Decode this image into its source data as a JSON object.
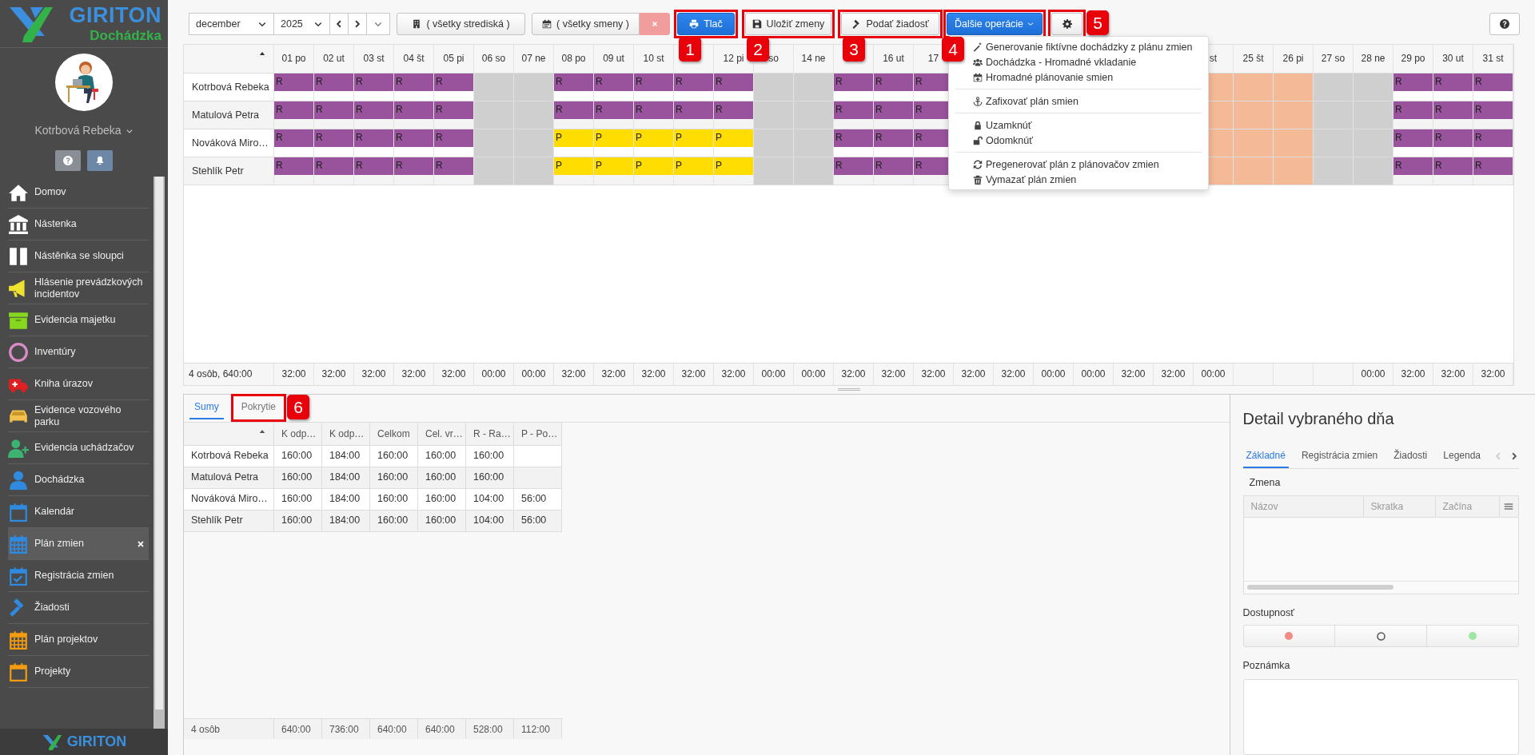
{
  "sidebar": {
    "brand": {
      "name": "GIRITON",
      "product": "Dochádzka"
    },
    "user": {
      "name": "Kotrbová Rebeka"
    },
    "items": [
      {
        "label": "Domov",
        "selected": false
      },
      {
        "label": "Nástenka",
        "selected": false
      },
      {
        "label": "Nástěnka se sloupci",
        "selected": false
      },
      {
        "label": "Hlásenie prevádzkových incidentov",
        "selected": false
      },
      {
        "label": "Evidencia majetku",
        "selected": false
      },
      {
        "label": "Inventúry",
        "selected": false
      },
      {
        "label": "Kniha úrazov",
        "selected": false
      },
      {
        "label": "Evidence vozového parku",
        "selected": false
      },
      {
        "label": "Evidencia uchádzačov",
        "selected": false
      },
      {
        "label": "Dochádzka",
        "selected": false
      },
      {
        "label": "Kalendár",
        "selected": false
      },
      {
        "label": "Plán zmien",
        "selected": true,
        "closable": true
      },
      {
        "label": "Registrácia zmien",
        "selected": false
      },
      {
        "label": "Žiadosti",
        "selected": false
      },
      {
        "label": "Plán projektov",
        "selected": false
      },
      {
        "label": "Projekty",
        "selected": false
      }
    ],
    "footer_brand": "GIRITON"
  },
  "toolbar": {
    "month": "december",
    "year": "2025",
    "period_menu_disabled": true,
    "centers": "( všetky strediská )",
    "shifts": "( všetky smeny )",
    "buttons": [
      {
        "label": "Tlač",
        "kind": "primary",
        "highlighted": true,
        "step": "1"
      },
      {
        "label": "Uložiť zmeny",
        "kind": "default",
        "highlighted": true,
        "step": "2"
      },
      {
        "label": "Podať žiadosť",
        "kind": "default",
        "highlighted": true,
        "step": "3"
      },
      {
        "label": "Ďalšie operácie",
        "kind": "primary-dropdown",
        "highlighted": true,
        "step": "4"
      },
      {
        "kind": "icon",
        "highlighted": true,
        "step": "5"
      }
    ]
  },
  "menu": {
    "open": true,
    "items": [
      {
        "kind": "item",
        "label": "Generovanie fiktívne dochádzky z plánu zmien"
      },
      {
        "kind": "item",
        "label": "Dochádzka - Hromadné vkladanie"
      },
      {
        "kind": "item",
        "label": "Hromadné plánovanie smien"
      },
      {
        "kind": "divider"
      },
      {
        "kind": "item",
        "label": "Zafixovať plán smien"
      },
      {
        "kind": "divider"
      },
      {
        "kind": "item",
        "label": "Uzamknúť"
      },
      {
        "kind": "item",
        "label": "Odomknúť"
      },
      {
        "kind": "divider"
      },
      {
        "kind": "item",
        "label": "Pregenerovať plán z plánovačov zmien"
      },
      {
        "kind": "item",
        "label": "Vymazať plán zmien"
      }
    ]
  },
  "calendar": {
    "days": [
      {
        "header": "01 po",
        "total": "32:00"
      },
      {
        "header": "02 ut",
        "total": "32:00"
      },
      {
        "header": "03 st",
        "total": "32:00"
      },
      {
        "header": "04 št",
        "total": "32:00"
      },
      {
        "header": "05 pi",
        "total": "32:00"
      },
      {
        "header": "06 so",
        "total": "00:00"
      },
      {
        "header": "07 ne",
        "total": "00:00"
      },
      {
        "header": "08 po",
        "total": "32:00"
      },
      {
        "header": "09 ut",
        "total": "32:00"
      },
      {
        "header": "10 st",
        "total": "32:00"
      },
      {
        "total": "32:00"
      },
      {
        "header": "12 pi",
        "total": "32:00"
      },
      {
        "header": "so",
        "total": "00:00"
      },
      {
        "header": "14 ne",
        "total": "00:00"
      },
      {
        "total": "32:00"
      },
      {
        "header": "16 ut",
        "total": "32:00"
      },
      {
        "header": "17",
        "total": "32:00"
      },
      {
        "total": "32:00"
      },
      {
        "total": "32:00"
      },
      {
        "total": "00:00"
      },
      {
        "total": "00:00"
      },
      {
        "total": "32:00"
      },
      {
        "total": "32:00"
      },
      {
        "header": "st",
        "total": "00:00"
      },
      {
        "header": "25 št"
      },
      {
        "header": "26 pi"
      },
      {
        "header": "27 so"
      },
      {
        "header": "28 ne",
        "total": "00:00"
      },
      {
        "header": "29 po",
        "total": "32:00"
      },
      {
        "header": "30 ut",
        "total": "32:00"
      },
      {
        "header": "31 st",
        "total": "32:00"
      }
    ],
    "people": [
      {
        "name": "Kotrbová Rebeka",
        "cells": [
          {
            "kind": "shift",
            "code": "R",
            "color": "#98539c"
          },
          {
            "kind": "shift",
            "code": "R",
            "color": "#98539c"
          },
          {
            "kind": "shift",
            "code": "R",
            "color": "#98539c"
          },
          {
            "kind": "shift",
            "code": "R",
            "color": "#98539c"
          },
          {
            "kind": "shift",
            "code": "R",
            "color": "#98539c"
          },
          {
            "kind": "weekend"
          },
          {
            "kind": "weekend"
          },
          {
            "kind": "shift",
            "code": "R",
            "color": "#98539c"
          },
          {
            "kind": "shift",
            "code": "R",
            "color": "#98539c"
          },
          {
            "kind": "shift",
            "code": "R",
            "color": "#98539c"
          },
          {
            "kind": "shift",
            "code": "R",
            "color": "#98539c"
          },
          {
            "kind": "shift",
            "code": "R",
            "color": "#98539c"
          },
          {
            "kind": "weekend"
          },
          {
            "kind": "weekend"
          },
          {
            "kind": "shift",
            "code": "R",
            "color": "#98539c"
          },
          {
            "kind": "shift",
            "code": "R",
            "color": "#98539c"
          },
          {
            "kind": "shift",
            "code": "R",
            "color": "#98539c"
          },
          null,
          null,
          null,
          null,
          null,
          null,
          {
            "kind": "holiday"
          },
          {
            "kind": "holiday"
          },
          {
            "kind": "holiday"
          },
          {
            "kind": "weekend"
          },
          {
            "kind": "weekend"
          },
          {
            "kind": "shift",
            "code": "R",
            "color": "#98539c"
          },
          {
            "kind": "shift",
            "code": "R",
            "color": "#98539c"
          },
          {
            "kind": "shift",
            "code": "R",
            "color": "#98539c"
          }
        ]
      },
      {
        "name": "Matulová Petra",
        "cells": [
          {
            "kind": "shift",
            "code": "R",
            "color": "#98539c"
          },
          {
            "kind": "shift",
            "code": "R",
            "color": "#98539c"
          },
          {
            "kind": "shift",
            "code": "R",
            "color": "#98539c"
          },
          {
            "kind": "shift",
            "code": "R",
            "color": "#98539c"
          },
          {
            "kind": "shift",
            "code": "R",
            "color": "#98539c"
          },
          {
            "kind": "weekend"
          },
          {
            "kind": "weekend"
          },
          {
            "kind": "shift",
            "code": "R",
            "color": "#98539c"
          },
          {
            "kind": "shift",
            "code": "R",
            "color": "#98539c"
          },
          {
            "kind": "shift",
            "code": "R",
            "color": "#98539c"
          },
          {
            "kind": "shift",
            "code": "R",
            "color": "#98539c"
          },
          {
            "kind": "shift",
            "code": "R",
            "color": "#98539c"
          },
          {
            "kind": "weekend"
          },
          {
            "kind": "weekend"
          },
          {
            "kind": "shift",
            "code": "R",
            "color": "#98539c"
          },
          {
            "kind": "shift",
            "code": "R",
            "color": "#98539c"
          },
          {
            "kind": "shift",
            "code": "R",
            "color": "#98539c"
          },
          null,
          null,
          null,
          null,
          null,
          null,
          {
            "kind": "holiday"
          },
          {
            "kind": "holiday"
          },
          {
            "kind": "holiday"
          },
          {
            "kind": "weekend"
          },
          {
            "kind": "weekend"
          },
          {
            "kind": "shift",
            "code": "R",
            "color": "#98539c"
          },
          {
            "kind": "shift",
            "code": "R",
            "color": "#98539c"
          },
          {
            "kind": "shift",
            "code": "R",
            "color": "#98539c"
          }
        ]
      },
      {
        "name": "Nováková Miro…",
        "cells": [
          {
            "kind": "shift",
            "code": "R",
            "color": "#98539c"
          },
          {
            "kind": "shift",
            "code": "R",
            "color": "#98539c"
          },
          {
            "kind": "shift",
            "code": "R",
            "color": "#98539c"
          },
          {
            "kind": "shift",
            "code": "R",
            "color": "#98539c"
          },
          {
            "kind": "shift",
            "code": "R",
            "color": "#98539c"
          },
          {
            "kind": "weekend"
          },
          {
            "kind": "weekend"
          },
          {
            "kind": "shift",
            "code": "P",
            "color": "#ffdd00"
          },
          {
            "kind": "shift",
            "code": "P",
            "color": "#ffdd00"
          },
          {
            "kind": "shift",
            "code": "P",
            "color": "#ffdd00"
          },
          {
            "kind": "shift",
            "code": "P",
            "color": "#ffdd00"
          },
          {
            "kind": "shift",
            "code": "P",
            "color": "#ffdd00"
          },
          {
            "kind": "weekend"
          },
          {
            "kind": "weekend"
          },
          {
            "kind": "shift",
            "code": "R",
            "color": "#98539c"
          },
          {
            "kind": "shift",
            "code": "R",
            "color": "#98539c"
          },
          {
            "kind": "shift",
            "code": "R",
            "color": "#98539c"
          },
          null,
          null,
          null,
          null,
          null,
          null,
          {
            "kind": "holiday"
          },
          {
            "kind": "holiday"
          },
          {
            "kind": "holiday"
          },
          {
            "kind": "weekend"
          },
          {
            "kind": "weekend"
          },
          {
            "kind": "shift",
            "code": "R",
            "color": "#98539c"
          },
          {
            "kind": "shift",
            "code": "R",
            "color": "#98539c"
          },
          {
            "kind": "shift",
            "code": "R",
            "color": "#98539c"
          }
        ]
      },
      {
        "name": "Stehlík Petr",
        "cells": [
          {
            "kind": "shift",
            "code": "R",
            "color": "#98539c"
          },
          {
            "kind": "shift",
            "code": "R",
            "color": "#98539c"
          },
          {
            "kind": "shift",
            "code": "R",
            "color": "#98539c"
          },
          {
            "kind": "shift",
            "code": "R",
            "color": "#98539c"
          },
          {
            "kind": "shift",
            "code": "R",
            "color": "#98539c"
          },
          {
            "kind": "weekend"
          },
          {
            "kind": "weekend"
          },
          {
            "kind": "shift",
            "code": "P",
            "color": "#ffdd00"
          },
          {
            "kind": "shift",
            "code": "P",
            "color": "#ffdd00"
          },
          {
            "kind": "shift",
            "code": "P",
            "color": "#ffdd00"
          },
          {
            "kind": "shift",
            "code": "P",
            "color": "#ffdd00"
          },
          {
            "kind": "shift",
            "code": "P",
            "color": "#ffdd00"
          },
          {
            "kind": "weekend"
          },
          {
            "kind": "weekend"
          },
          {
            "kind": "shift",
            "code": "R",
            "color": "#98539c"
          },
          {
            "kind": "shift",
            "code": "R",
            "color": "#98539c"
          },
          {
            "kind": "shift",
            "code": "R",
            "color": "#98539c"
          },
          null,
          null,
          null,
          null,
          null,
          null,
          {
            "kind": "holiday"
          },
          {
            "kind": "holiday"
          },
          {
            "kind": "holiday"
          },
          {
            "kind": "weekend"
          },
          {
            "kind": "weekend"
          },
          {
            "kind": "shift",
            "code": "R",
            "color": "#98539c"
          },
          {
            "kind": "shift",
            "code": "R",
            "color": "#98539c"
          },
          {
            "kind": "shift",
            "code": "R",
            "color": "#98539c"
          }
        ]
      }
    ],
    "footer_label": "4 osôb, 640:00"
  },
  "summary": {
    "tabs": [
      {
        "label": "Sumy",
        "selected": true,
        "highlighted": false
      },
      {
        "label": "Pokrytie",
        "selected": false,
        "highlighted": true,
        "step": "6"
      }
    ],
    "columns": [
      "K odp…",
      "K odp…",
      "Celkom",
      "Cel. vr…",
      "R - Ra…",
      "P - Po…"
    ],
    "rows": [
      {
        "name": "Kotrbová Rebeka",
        "values": [
          "160:00",
          "184:00",
          "160:00",
          "160:00",
          "160:00"
        ]
      },
      {
        "name": "Matulová Petra",
        "values": [
          "160:00",
          "184:00",
          "160:00",
          "160:00",
          "160:00"
        ]
      },
      {
        "name": "Nováková Miro…",
        "values": [
          "160:00",
          "184:00",
          "160:00",
          "160:00",
          "104:00",
          "56:00"
        ]
      },
      {
        "name": "Stehlík Petr",
        "values": [
          "160:00",
          "184:00",
          "160:00",
          "160:00",
          "104:00",
          "56:00"
        ]
      }
    ],
    "footer": {
      "label": "4 osôb",
      "values": [
        "640:00",
        "736:00",
        "640:00",
        "640:00",
        "528:00",
        "112:00"
      ]
    }
  },
  "detail": {
    "title": "Detail vybraného dňa",
    "tabs": [
      {
        "label": "Základné",
        "selected": true
      },
      {
        "label": "Registrácia zmien",
        "selected": false
      },
      {
        "label": "Žiadosti",
        "selected": false
      },
      {
        "label": "Legenda",
        "selected": false
      }
    ],
    "tab_scroll": {
      "prev_disabled": true,
      "next_disabled": false
    },
    "shift": {
      "label": "Zmena",
      "columns": [
        "Názov",
        "Skratka",
        "Začína"
      ]
    },
    "availability": {
      "label": "Dostupnosť",
      "options": [
        {
          "kind": "dot",
          "color": "#f28a85"
        },
        {
          "kind": "ring",
          "color": "#555555"
        },
        {
          "kind": "dot",
          "color": "#9ee6a3"
        }
      ]
    },
    "note": {
      "label": "Poznámka"
    }
  }
}
